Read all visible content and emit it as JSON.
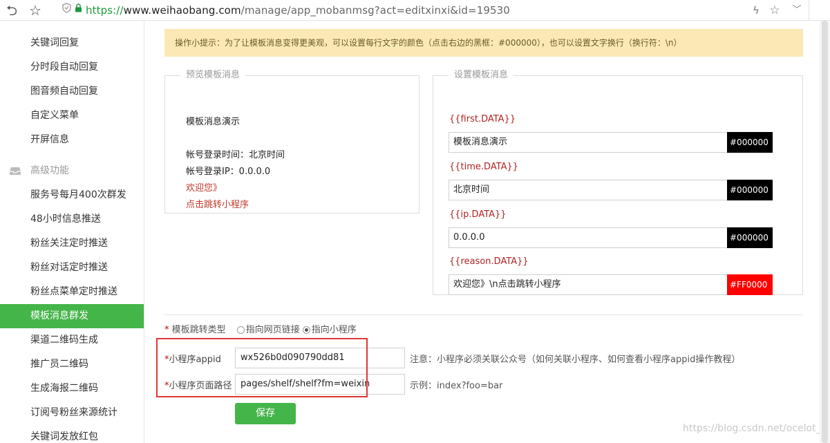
{
  "browser": {
    "url_scheme": "https://",
    "url_host": "www.weihaobang.com",
    "url_path": "/manage/app_mobanmsg?act=editxinxi&id=19530"
  },
  "sidebar": {
    "items": [
      {
        "label": "关键词回复"
      },
      {
        "label": "分时段自动回复"
      },
      {
        "label": "图音频自动回复"
      },
      {
        "label": "自定义菜单"
      },
      {
        "label": "开屏信息"
      }
    ],
    "group_label": "高级功能",
    "group_items": [
      {
        "label": "服务号每月400次群发"
      },
      {
        "label": "48小时信息推送"
      },
      {
        "label": "粉丝关注定时推送"
      },
      {
        "label": "粉丝对话定时推送"
      },
      {
        "label": "粉丝点菜单定时推送"
      },
      {
        "label": "模板消息群发",
        "active": true
      },
      {
        "label": "渠道二维码生成"
      },
      {
        "label": "推广员二维码"
      },
      {
        "label": "生成海报二维码"
      },
      {
        "label": "订阅号粉丝来源统计"
      },
      {
        "label": "关键词发放红包"
      }
    ]
  },
  "notice": "操作小提示：为了让模板消息变得更美观，可以设置每行文字的颜色（点击右边的黑框：#000000），也可以设置文字换行（换行符：\\n）",
  "preview": {
    "legend": "预览模板消息",
    "first": "模板消息演示",
    "line_time": "帐号登录时间：北京时间",
    "line_ip": "帐号登录IP：0.0.0.0",
    "line_reason1": "欢迎您》",
    "line_reason2": "点击跳转小程序"
  },
  "setting": {
    "legend": "设置模板消息",
    "fields": [
      {
        "key": "{{first.DATA}}",
        "value": "模板消息演示",
        "color": "#000000"
      },
      {
        "key": "{{time.DATA}}",
        "value": "北京时间",
        "color": "#000000"
      },
      {
        "key": "{{ip.DATA}}",
        "value": "0.0.0.0",
        "color": "#000000"
      },
      {
        "key": "{{reason.DATA}}",
        "value": "欢迎您》\\n点击跳转小程序",
        "color": "#FF0000"
      }
    ]
  },
  "jump": {
    "required_mark": "*",
    "label": " 模板跳转类型",
    "option_web": "指向网页链接",
    "option_mini": "指向小程序",
    "selected": "指向小程序"
  },
  "form": {
    "appid_label": "小程序appid",
    "appid_value": "wx526b0d090790dd81",
    "appid_hint": "注意：小程序必须关联公众号（如何关联小程序、如何查看小程序appid操作教程）",
    "path_label": "小程序页面路径",
    "path_value": "pages/shelf/shelf?fm=weixin",
    "path_hint": "示例：index?foo=bar"
  },
  "save_label": "保存",
  "watermark": "https://blog.csdn.net/ocelot_z"
}
